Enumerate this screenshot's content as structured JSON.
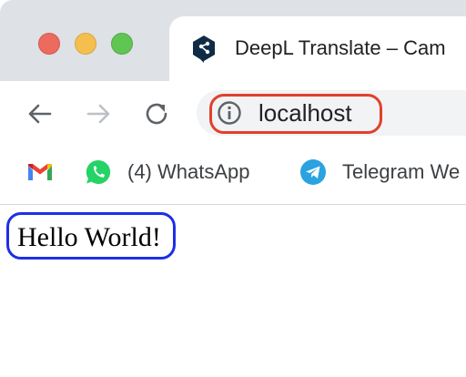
{
  "window": {
    "traffic_lights": [
      "close",
      "minimize",
      "maximize"
    ],
    "colors": {
      "close": "#ed6a5e",
      "minimize": "#f5bf4f",
      "maximize": "#61c554"
    }
  },
  "tab": {
    "title": "DeepL Translate – Cam",
    "icon": "deepl-icon"
  },
  "toolbar": {
    "back_icon": "back-arrow-icon",
    "forward_icon": "forward-arrow-icon",
    "reload_icon": "reload-icon",
    "address": {
      "url": "localhost",
      "icon": "info-icon",
      "highlight_color": "#e2402e"
    }
  },
  "bookmarks": [
    {
      "label": "",
      "icon": "gmail-icon"
    },
    {
      "label": "(4) WhatsApp",
      "icon": "whatsapp-icon"
    },
    {
      "label": "Telegram We",
      "icon": "telegram-icon"
    }
  ],
  "page": {
    "text": "Hello World!",
    "highlight_color": "#1e2fe6"
  }
}
